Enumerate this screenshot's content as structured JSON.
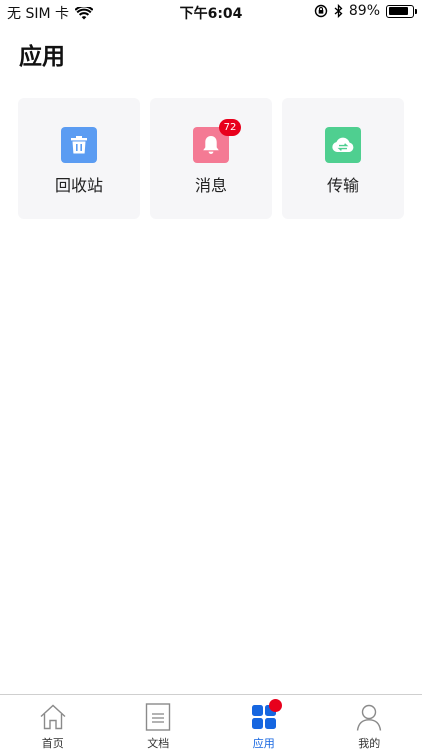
{
  "status_bar": {
    "carrier": "无 SIM 卡",
    "time": "下午6:04",
    "battery_percent": "89%",
    "battery_level": 0.89
  },
  "page": {
    "title": "应用"
  },
  "apps": [
    {
      "label": "回收站",
      "icon": "trash-icon",
      "color": "#5b9cf2"
    },
    {
      "label": "消息",
      "icon": "bell-icon",
      "color": "#f47a94",
      "badge": "72"
    },
    {
      "label": "传输",
      "icon": "cloud-transfer-icon",
      "color": "#4fcf90"
    }
  ],
  "tab_bar": {
    "items": [
      {
        "label": "首页",
        "icon": "home-icon"
      },
      {
        "label": "文档",
        "icon": "document-icon"
      },
      {
        "label": "应用",
        "icon": "apps-grid-icon",
        "active": true
      },
      {
        "label": "我的",
        "icon": "user-icon"
      }
    ],
    "active_color": "#1666e0",
    "dot_color": "#e8001c"
  }
}
